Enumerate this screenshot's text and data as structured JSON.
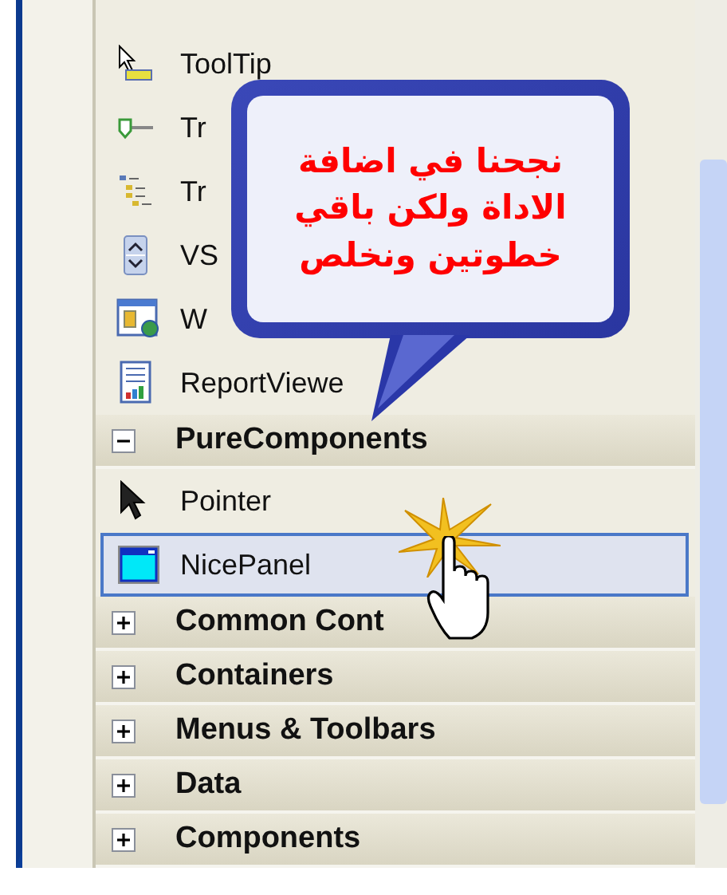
{
  "toolbox": {
    "rows": [
      {
        "kind": "item",
        "label": "ToolTip",
        "selected": false
      },
      {
        "kind": "item",
        "label": "Tr",
        "selected": false
      },
      {
        "kind": "item",
        "label": "Tr",
        "selected": false
      },
      {
        "kind": "item",
        "label": "VS",
        "selected": false
      },
      {
        "kind": "item",
        "label": "W",
        "selected": false
      },
      {
        "kind": "item",
        "label": "ReportViewe",
        "selected": false
      },
      {
        "kind": "group",
        "label": "PureComponents",
        "expanded": true
      },
      {
        "kind": "item",
        "label": "Pointer",
        "selected": false
      },
      {
        "kind": "item",
        "label": "NicePanel",
        "selected": true
      },
      {
        "kind": "group",
        "label": "Common Cont",
        "expanded": false
      },
      {
        "kind": "group",
        "label": "Containers",
        "expanded": false
      },
      {
        "kind": "group",
        "label": "Menus & Toolbars",
        "expanded": false
      },
      {
        "kind": "group",
        "label": "Data",
        "expanded": false
      },
      {
        "kind": "group",
        "label": "Components",
        "expanded": false
      }
    ]
  },
  "callout": {
    "lines": [
      "نجحنا في اضافة",
      "الاداة ولكن باقي",
      "خطوتين ونخلص"
    ]
  }
}
